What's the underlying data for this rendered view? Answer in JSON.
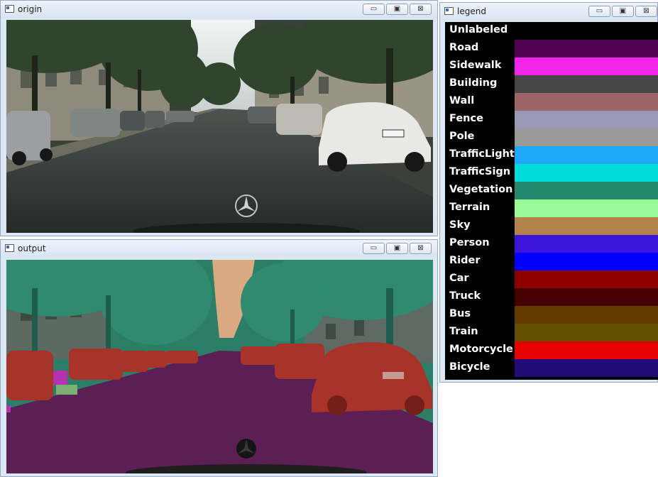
{
  "windows": {
    "origin": {
      "title": "origin"
    },
    "output": {
      "title": "output"
    },
    "legend": {
      "title": "legend"
    }
  },
  "controls": {
    "minimize": "▭",
    "maximize": "▣",
    "close": "⊠"
  },
  "legend_items": [
    {
      "label": "Unlabeled",
      "color": "#000000"
    },
    {
      "label": "Road",
      "color": "#4f0050"
    },
    {
      "label": "Sidewalk",
      "color": "#f025e8"
    },
    {
      "label": "Building",
      "color": "#464646"
    },
    {
      "label": "Wall",
      "color": "#9c6666"
    },
    {
      "label": "Fence",
      "color": "#9a99b5"
    },
    {
      "label": "Pole",
      "color": "#999999"
    },
    {
      "label": "TrafficLight",
      "color": "#1ea8f9"
    },
    {
      "label": "TrafficSign",
      "color": "#00dcdc"
    },
    {
      "label": "Vegetation",
      "color": "#23876d"
    },
    {
      "label": "Terrain",
      "color": "#98fb98"
    },
    {
      "label": "Sky",
      "color": "#b4824b"
    },
    {
      "label": "Person",
      "color": "#3c14dc"
    },
    {
      "label": "Rider",
      "color": "#0000ff"
    },
    {
      "label": "Car",
      "color": "#8e0000"
    },
    {
      "label": "Truck",
      "color": "#460000"
    },
    {
      "label": "Bus",
      "color": "#643c00"
    },
    {
      "label": "Train",
      "color": "#645000"
    },
    {
      "label": "Motorcycle",
      "color": "#e60000"
    },
    {
      "label": "Bicycle",
      "color": "#200b77"
    }
  ]
}
